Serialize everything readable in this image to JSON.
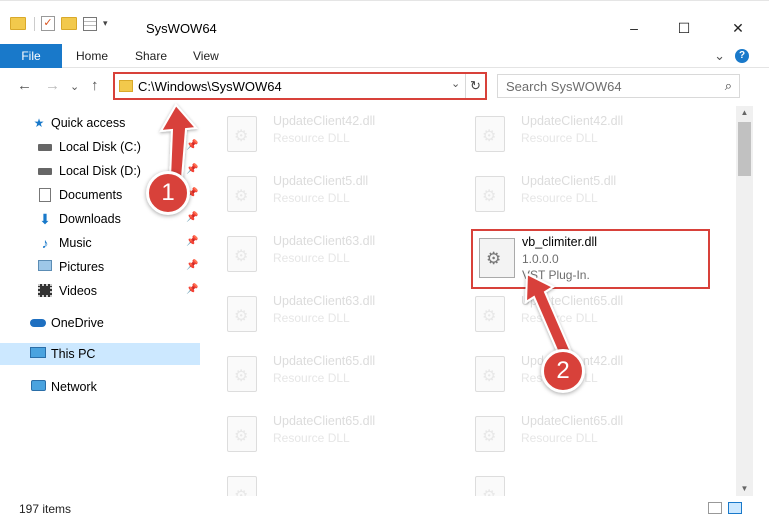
{
  "window": {
    "title": "SysWOW64",
    "minimize": "–",
    "maximize": "☐",
    "close": "✕"
  },
  "ribbon": {
    "tabs": [
      "File",
      "Home",
      "Share",
      "View"
    ],
    "help": "?",
    "expand": "⌄"
  },
  "nav": {
    "back": "←",
    "forward": "→",
    "recent": "⌄",
    "up": "↑",
    "address": "C:\\Windows\\SysWOW64",
    "refresh": "↻",
    "search_placeholder": "Search SysWOW64",
    "search_icon": "⌕"
  },
  "sidebar": {
    "items": [
      {
        "label": "Quick access",
        "icon": "star-icon"
      },
      {
        "label": "Local Disk (C:)",
        "icon": "drive-icon",
        "pinned": true
      },
      {
        "label": "Local Disk (D:)",
        "icon": "drive-icon",
        "pinned": true
      },
      {
        "label": "Documents",
        "icon": "documents-icon",
        "pinned": true
      },
      {
        "label": "Downloads",
        "icon": "downloads-icon",
        "pinned": true
      },
      {
        "label": "Music",
        "icon": "music-icon",
        "pinned": true
      },
      {
        "label": "Pictures",
        "icon": "pictures-icon",
        "pinned": true
      },
      {
        "label": "Videos",
        "icon": "videos-icon",
        "pinned": true
      },
      {
        "label": "OneDrive",
        "icon": "cloud-icon"
      },
      {
        "label": "This PC",
        "icon": "computer-icon",
        "selected": true
      },
      {
        "label": "Network",
        "icon": "network-icon"
      }
    ]
  },
  "files": [
    {
      "name": "UpdateClient42.dll",
      "desc": "Resource DLL"
    },
    {
      "name": "UpdateClient42.dll",
      "desc": "Resource DLL"
    },
    {
      "name": "UpdateClient5.dll",
      "desc": "Resource DLL"
    },
    {
      "name": "UpdateClient5.dll",
      "desc": "Resource DLL"
    },
    {
      "name": "UpdateClient63.dll",
      "desc": "Resource DLL"
    },
    {
      "name": "UpdateClient63.dll",
      "desc": "Resource DLL"
    },
    {
      "name": "UpdateClient63.dll",
      "desc": "Resource DLL"
    },
    {
      "name": "UpdateClient65.dll",
      "desc": "Resource DLL"
    },
    {
      "name": "UpdateClient65.dll",
      "desc": "Resource DLL"
    },
    {
      "name": "UpdateClient42.dll",
      "desc": "Resource DLL"
    },
    {
      "name": "UpdateClient65.dll",
      "desc": "Resource DLL"
    },
    {
      "name": "UpdateClient65.dll",
      "desc": "Resource DLL"
    }
  ],
  "highlighted_file": {
    "name": "vb_climiter.dll",
    "version": "1.0.0.0",
    "type": "VST Plug-In."
  },
  "status": {
    "items": "197 items"
  },
  "callouts": [
    "1",
    "2"
  ],
  "colors": {
    "accent": "#1979ca",
    "highlight": "#d8413a",
    "selected": "#cce8ff"
  }
}
